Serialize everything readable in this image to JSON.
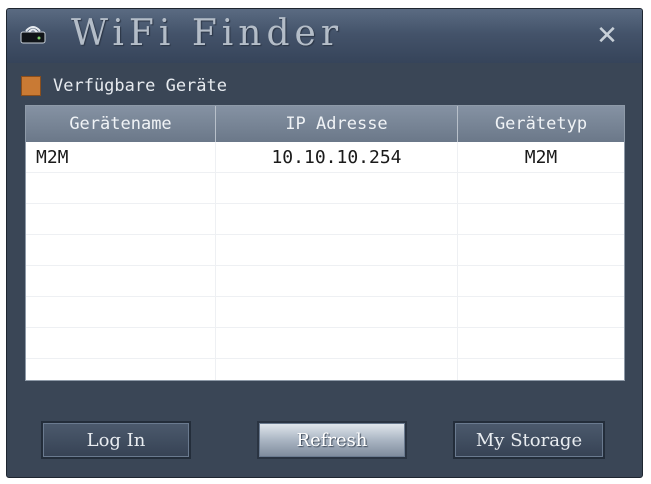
{
  "window": {
    "title": "WiFi Finder",
    "close_label": "✕"
  },
  "section": {
    "label": "Verfügbare Geräte"
  },
  "table": {
    "headers": [
      "Gerätename",
      "IP Adresse",
      "Gerätetyp"
    ],
    "rows": [
      [
        "M2M",
        "10.10.10.254",
        "M2M"
      ],
      [
        "",
        "",
        ""
      ],
      [
        "",
        "",
        ""
      ],
      [
        "",
        "",
        ""
      ],
      [
        "",
        "",
        ""
      ],
      [
        "",
        "",
        ""
      ],
      [
        "",
        "",
        ""
      ],
      [
        "",
        "",
        ""
      ]
    ]
  },
  "buttons": {
    "login": "Log In",
    "refresh": "Refresh",
    "storage": "My Storage"
  },
  "icons": {
    "app": "router-icon",
    "close": "close-icon",
    "section": "orange-square-icon"
  },
  "colors": {
    "window_bg": "#3a4656",
    "header_bg": "#6b7889",
    "section_square": "#c97a34"
  }
}
